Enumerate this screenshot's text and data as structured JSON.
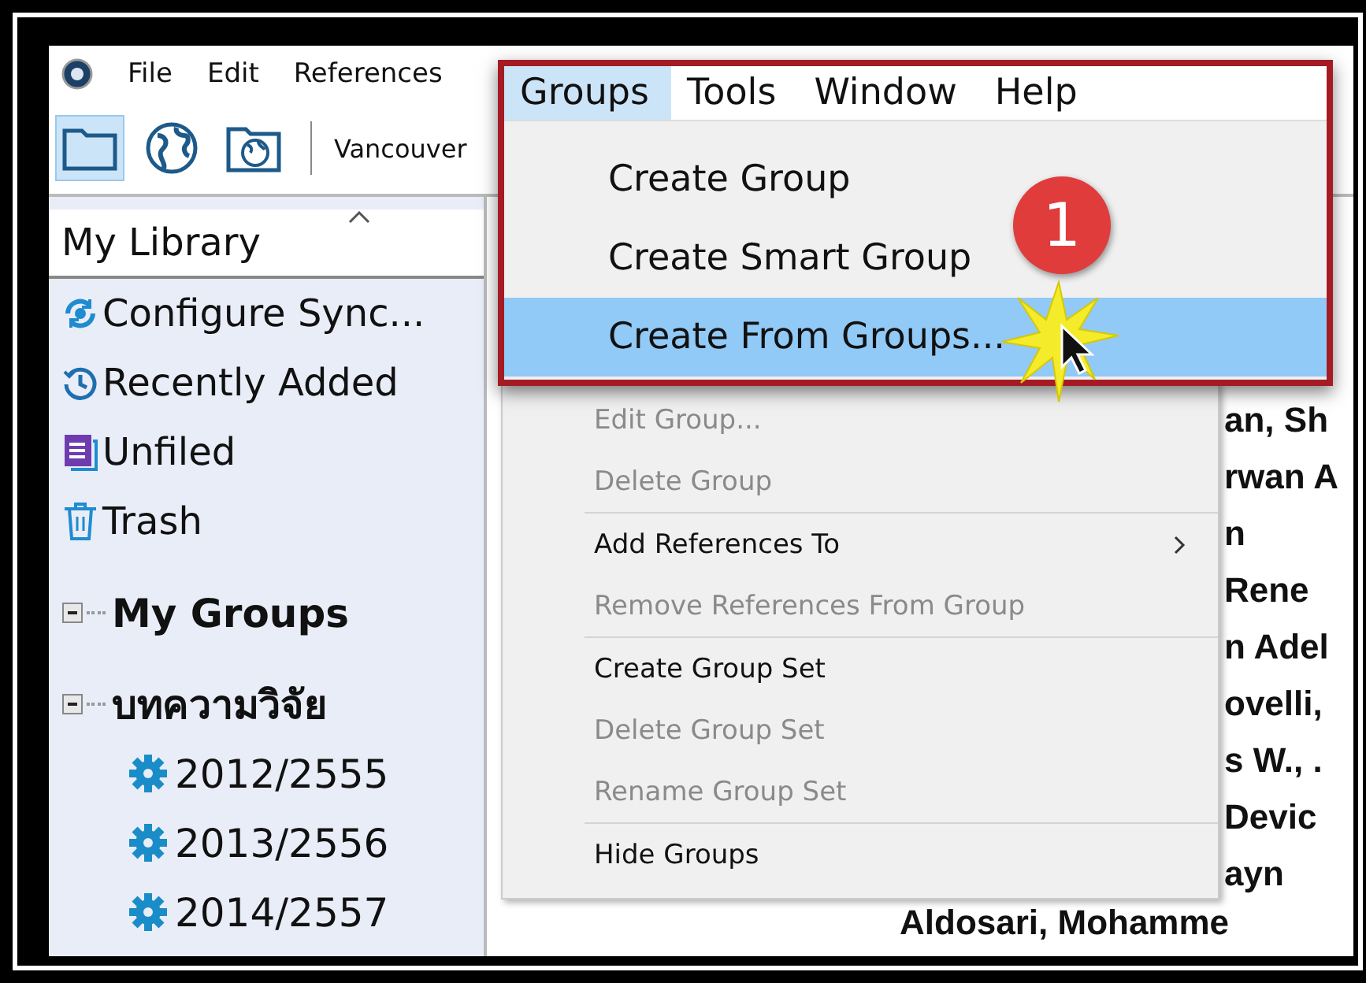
{
  "menu_bar": [
    {
      "label": "File"
    },
    {
      "label": "Edit"
    },
    {
      "label": "References"
    }
  ],
  "toolbar": {
    "buttons": [
      {
        "kind": "folder",
        "selected": true
      },
      {
        "kind": "globe",
        "selected": false
      },
      {
        "kind": "folder-globe",
        "selected": false
      }
    ],
    "style": "Vancouver"
  },
  "sidebar": {
    "header": "My Library",
    "items": [
      {
        "kind": "sync",
        "label": "Configure Sync..."
      },
      {
        "kind": "recent",
        "label": "Recently Added"
      },
      {
        "kind": "unfiled",
        "label": "Unfiled"
      },
      {
        "kind": "trash",
        "label": "Trash"
      }
    ],
    "groups": [
      {
        "label": "My Groups",
        "expanded": true
      },
      {
        "label": "บทความวิจัย",
        "expanded": true,
        "children": [
          {
            "label": "2012/2555"
          },
          {
            "label": "2013/2556"
          },
          {
            "label": "2014/2557"
          }
        ]
      }
    ]
  },
  "references": [
    "an, Sh",
    "rwan A",
    "n",
    "Rene",
    "n Adel",
    "ovelli,",
    "s W., .",
    "Devic",
    "ayn",
    "Aldosari, Mohamme"
  ],
  "callout": {
    "badge": "1",
    "menu_bar": [
      {
        "label": "Groups",
        "selected": true
      },
      {
        "label": "Tools",
        "selected": false
      },
      {
        "label": "Window",
        "selected": false
      },
      {
        "label": "Help",
        "selected": false
      }
    ],
    "items": [
      {
        "label": "Create Group",
        "selected": false
      },
      {
        "label": "Create Smart Group",
        "selected": false
      },
      {
        "label": "Create From Groups...",
        "selected": true
      }
    ]
  },
  "groups_menu": {
    "items": [
      {
        "kind": "item",
        "label": "Edit Group...",
        "disabled": true
      },
      {
        "kind": "item",
        "label": "Delete Group",
        "disabled": true
      },
      {
        "kind": "separator"
      },
      {
        "kind": "submenu",
        "label": "Add References To",
        "disabled": false
      },
      {
        "kind": "item",
        "label": "Remove References From Group",
        "disabled": true
      },
      {
        "kind": "separator"
      },
      {
        "kind": "item",
        "label": "Create Group Set",
        "disabled": false
      },
      {
        "kind": "item",
        "label": "Delete Group Set",
        "disabled": true
      },
      {
        "kind": "item",
        "label": "Rename Group Set",
        "disabled": true
      },
      {
        "kind": "separator"
      },
      {
        "kind": "item",
        "label": "Hide Groups",
        "disabled": false
      }
    ]
  }
}
